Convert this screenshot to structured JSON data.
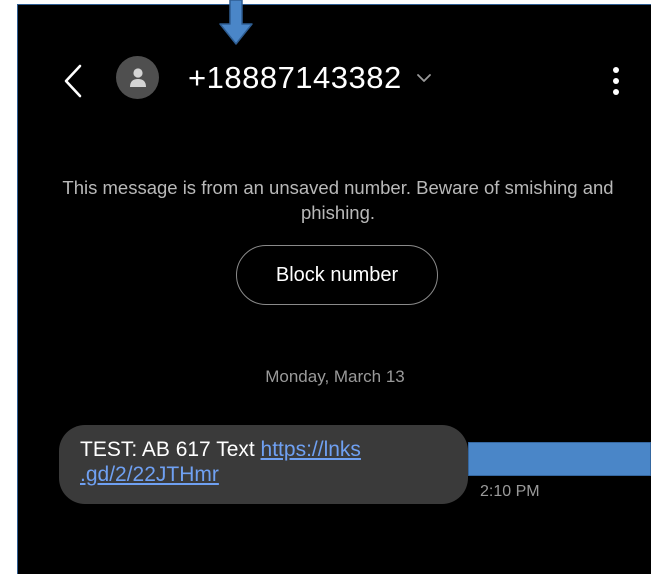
{
  "header": {
    "back_icon": "chevron-left-icon",
    "avatar_icon": "person-icon",
    "contact_number": "+18887143382",
    "expand_icon": "chevron-down-icon",
    "more_icon": "more-vertical-icon"
  },
  "warning": {
    "text": "This message is from an unsaved number. Beware of smishing and phishing."
  },
  "block_button": {
    "label": "Block number"
  },
  "conversation": {
    "date_label": "Monday, March 13",
    "messages": [
      {
        "text_prefix": "TEST: AB 617 Text ",
        "link_text": "https://lnks .gd/2/22JTHmr",
        "time": "2:10 PM"
      }
    ]
  },
  "annotations": {
    "arrow_color": "#4a86c8"
  },
  "colors": {
    "background": "#000000",
    "bubble": "#3a3a3a",
    "link": "#6fa0f2",
    "muted_text": "#9a9a9a"
  }
}
